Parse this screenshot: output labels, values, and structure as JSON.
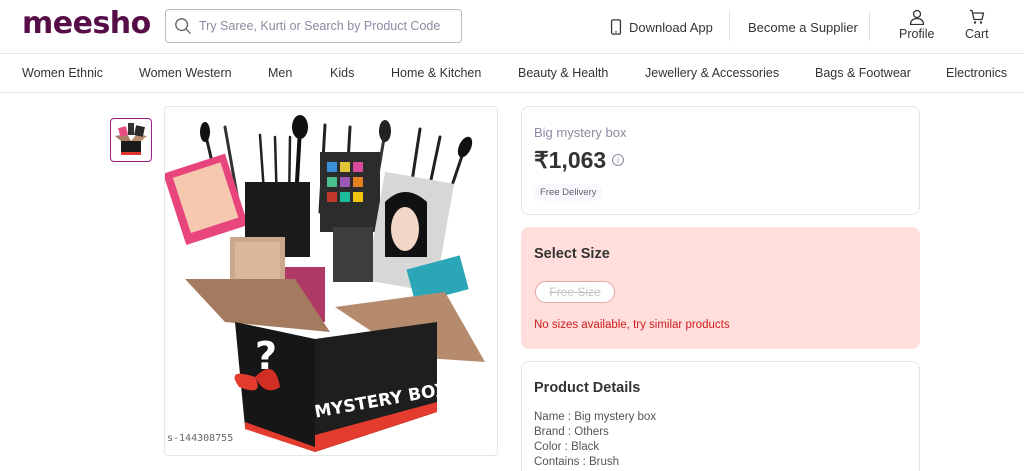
{
  "header": {
    "logo": "meesho",
    "search_placeholder": "Try Saree, Kurti or Search by Product Code",
    "download_app": "Download App",
    "become_supplier": "Become a Supplier",
    "profile": "Profile",
    "cart": "Cart"
  },
  "categories": [
    {
      "label": "Women Ethnic"
    },
    {
      "label": "Women Western"
    },
    {
      "label": "Men"
    },
    {
      "label": "Kids"
    },
    {
      "label": "Home & Kitchen"
    },
    {
      "label": "Beauty & Health"
    },
    {
      "label": "Jewellery & Accessories"
    },
    {
      "label": "Bags & Footwear"
    },
    {
      "label": "Electronics"
    }
  ],
  "product": {
    "image_label": "MYSTERY BOX",
    "sku_code": "s-144308755",
    "name": "Big mystery box",
    "price": "₹1,063",
    "free_delivery": "Free Delivery"
  },
  "size": {
    "title": "Select Size",
    "option": "Free Size",
    "message": "No sizes available, try similar products"
  },
  "details": {
    "title": "Product Details",
    "lines": [
      {
        "text": "Name : Big mystery box"
      },
      {
        "text": "Brand : Others"
      },
      {
        "text": "Color : Black"
      },
      {
        "text": "Contains : Brush"
      }
    ]
  },
  "colors": {
    "brand": "#570d48",
    "accent": "#9f2089",
    "error": "#cc1d1d",
    "size_panel_bg": "#ffdedc"
  },
  "icons": [
    "search-icon",
    "mobile-phone-icon",
    "user-icon",
    "cart-icon",
    "info-icon"
  ]
}
